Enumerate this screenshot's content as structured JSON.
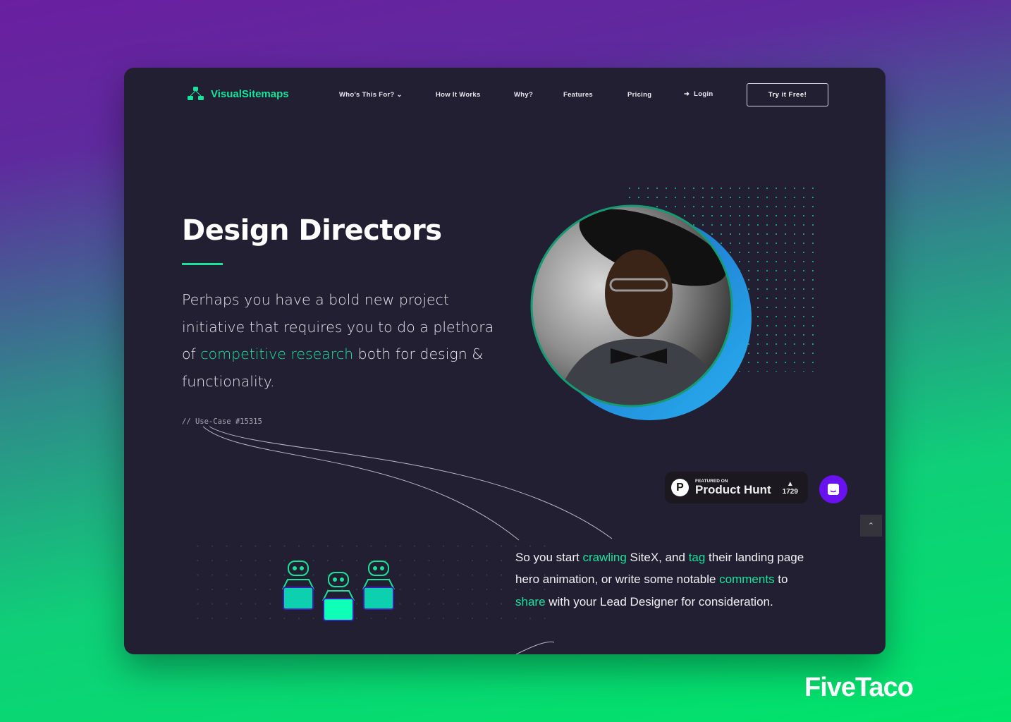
{
  "brand": "FiveTaco",
  "header": {
    "logo": "VisualSitemaps",
    "nav": [
      "Who's This For?",
      "How It Works",
      "Why?",
      "Features",
      "Pricing",
      "Login"
    ],
    "cta": "Try it Free!"
  },
  "hero": {
    "title": "Design Directors",
    "para_a": "Perhaps you have a bold new project initiative that requires you to do a plethora of ",
    "para_link": "competitive research",
    "para_b": " both for design & functionality.",
    "code": "// Use-Case #15315"
  },
  "section2": {
    "t1": "So you start ",
    "l1": "crawling",
    "t2": " SiteX, and ",
    "l2": "tag",
    "t3": " their landing page hero animation, or write some notable ",
    "l3": "comments",
    "t4": " to ",
    "l4": "share",
    "t5": " with your Lead Designer for consideration."
  },
  "product_hunt": {
    "featured": "FEATURED ON",
    "name": "Product Hunt",
    "votes": "1729"
  },
  "colors": {
    "accent": "#19e39a",
    "card": "#221f33",
    "chat": "#6a11f0"
  }
}
